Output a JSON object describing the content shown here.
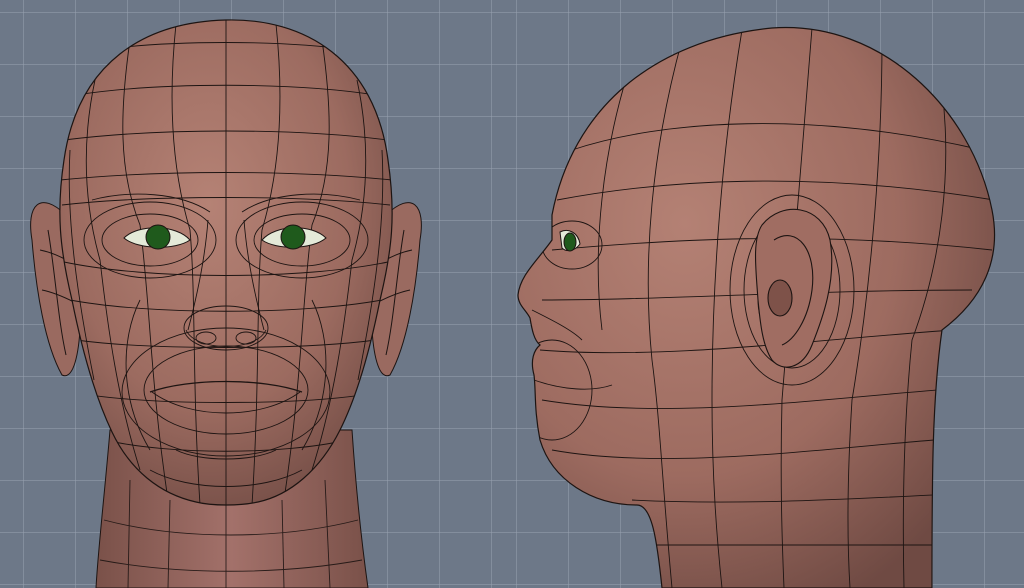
{
  "viewports": [
    {
      "view": "front"
    },
    {
      "view": "side"
    }
  ],
  "colors": {
    "background": "#6d7888",
    "grid": "#96a0af",
    "skin": "#a8756a",
    "skin_shadow": "#6f4a43",
    "wire": "#1d1412",
    "iris": "#1f5a1c",
    "sclera": "#e4ead8"
  }
}
